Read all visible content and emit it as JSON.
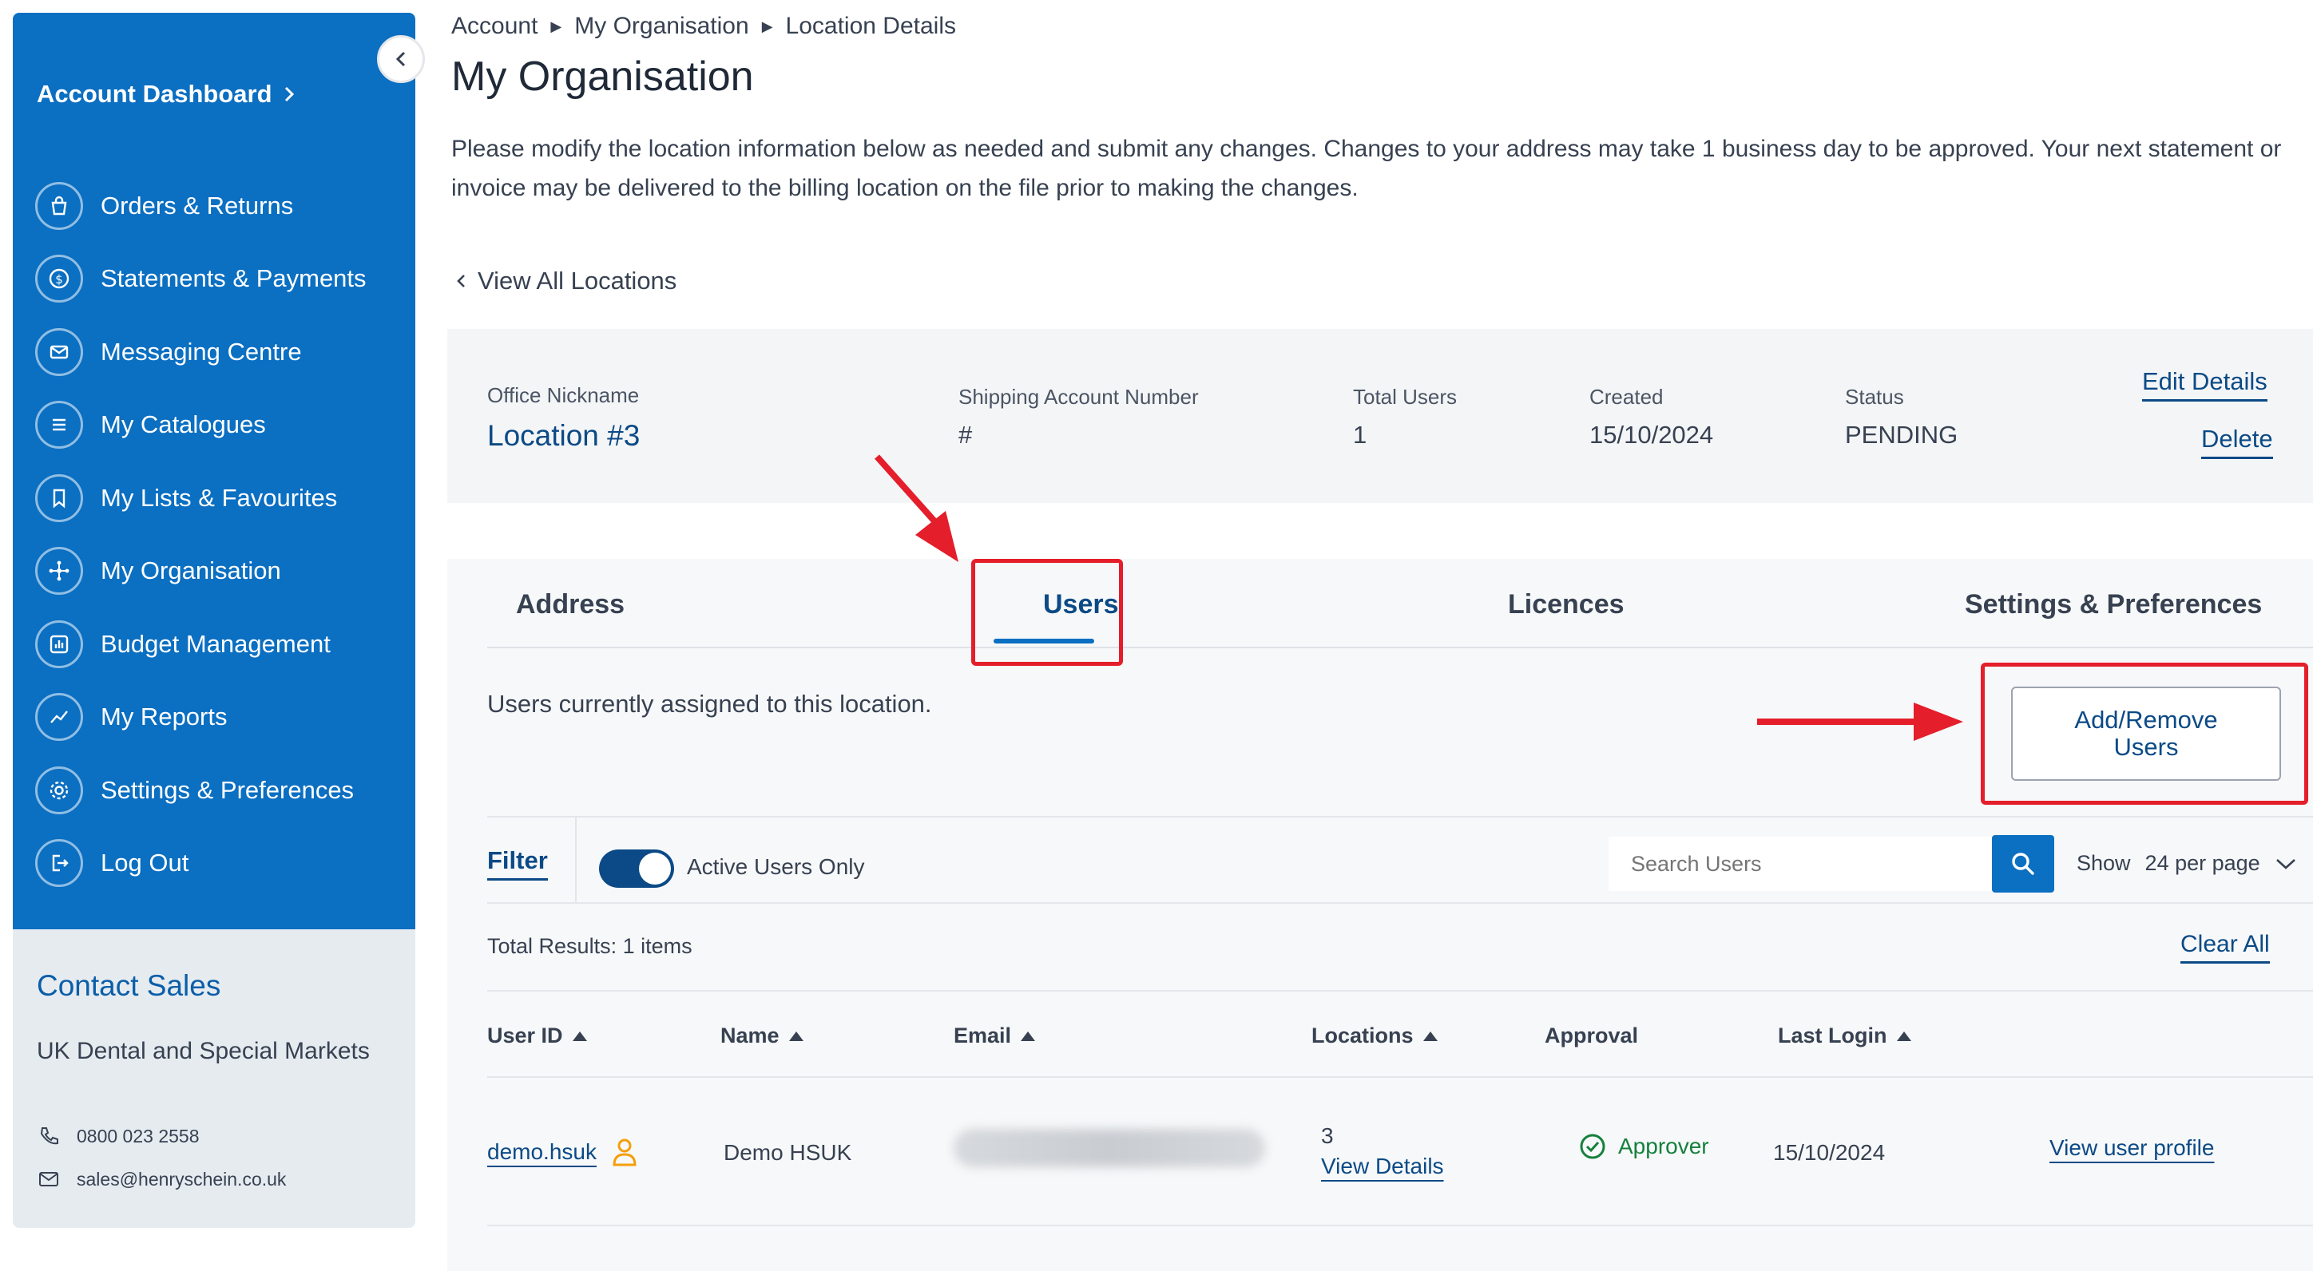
{
  "sidebar": {
    "title": "Account Dashboard",
    "items": [
      {
        "label": "Orders & Returns",
        "icon": "bag-icon"
      },
      {
        "label": "Statements & Payments",
        "icon": "dollar-icon"
      },
      {
        "label": "Messaging Centre",
        "icon": "mail-icon"
      },
      {
        "label": "My Catalogues",
        "icon": "list-icon"
      },
      {
        "label": "My Lists & Favourites",
        "icon": "bookmark-icon"
      },
      {
        "label": "My Organisation",
        "icon": "org-icon"
      },
      {
        "label": "Budget Management",
        "icon": "budget-icon"
      },
      {
        "label": "My Reports",
        "icon": "reports-icon"
      },
      {
        "label": "Settings & Preferences",
        "icon": "gear-icon"
      },
      {
        "label": "Log Out",
        "icon": "logout-icon"
      }
    ]
  },
  "contact": {
    "title": "Contact Sales",
    "region": "UK Dental and Special Markets",
    "phone": "0800 023 2558",
    "email": "sales@henryschein.co.uk"
  },
  "breadcrumb": [
    "Account",
    "My Organisation",
    "Location Details"
  ],
  "page": {
    "title": "My Organisation",
    "intro": "Please modify the location information below as needed and submit any changes. Changes to your address may take 1 business day to be approved. Your next statement or invoice may be delivered to the billing location on the file prior to making the changes.",
    "back_link": "View All Locations"
  },
  "location": {
    "nickname_label": "Office Nickname",
    "nickname": "Location #3",
    "shipping_label": "Shipping Account Number",
    "shipping": "#",
    "users_label": "Total Users",
    "users": "1",
    "created_label": "Created",
    "created": "15/10/2024",
    "status_label": "Status",
    "status": "PENDING",
    "edit": "Edit Details",
    "delete": "Delete"
  },
  "tabs": [
    "Address",
    "Users",
    "Licences",
    "Settings & Preferences"
  ],
  "users_panel": {
    "note": "Users currently assigned to this location.",
    "add_remove": "Add/Remove Users",
    "filter": "Filter",
    "toggle_label": "Active Users Only",
    "search_placeholder": "Search Users",
    "show_label": "Show",
    "per_page": "24 per page",
    "results": "Total Results: 1 items",
    "clear_all": "Clear All",
    "columns": [
      "User ID",
      "Name",
      "Email",
      "Locations",
      "Approval",
      "Last Login"
    ],
    "rows": [
      {
        "user_id": "demo.hsuk",
        "name": "Demo HSUK",
        "locations_count": "3",
        "locations_link": "View Details",
        "approval": "Approver",
        "last_login": "15/10/2024",
        "profile_link": "View user profile"
      }
    ]
  },
  "colors": {
    "brand_blue": "#0b6fc2",
    "link_navy": "#0b4a86",
    "annotation_red": "#e41e2b",
    "approve_green": "#15803d"
  }
}
